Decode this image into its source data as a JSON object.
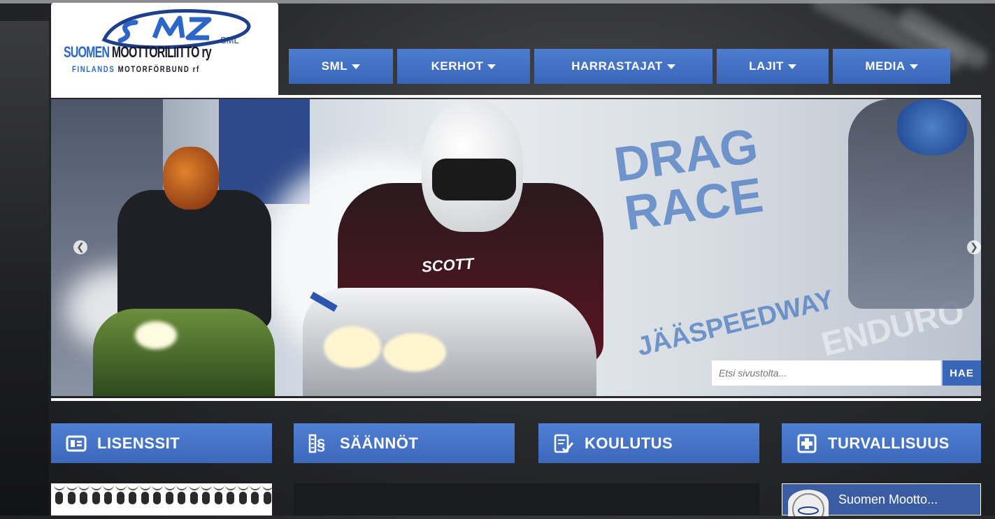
{
  "logo": {
    "mark_text": "SML",
    "name_part1": "SUOMEN",
    "name_part2": "MOOTTORILIITTO",
    "name_part3": "ry",
    "sub_part1": "FINLANDS",
    "sub_part2": "MOTORFÖRBUND rf"
  },
  "nav": {
    "items": [
      {
        "label": "SML"
      },
      {
        "label": "KERHOT"
      },
      {
        "label": "HARRASTAJAT"
      },
      {
        "label": "LAJIT"
      },
      {
        "label": "MEDIA"
      }
    ]
  },
  "hero": {
    "jersey": "SCOTT",
    "drag_line1": "DRAG",
    "drag_line2": "RACE",
    "speedway": "JÄÄSPEEDWAY",
    "enduro": "ENDURO"
  },
  "search": {
    "placeholder": "Etsi sivustolta...",
    "button": "HAE"
  },
  "quick_links": [
    {
      "label": "LISENSSIT",
      "icon": "id-card-icon"
    },
    {
      "label": "SÄÄNNÖT",
      "icon": "rules-paragraph-icon"
    },
    {
      "label": "KOULUTUS",
      "icon": "checklist-icon"
    },
    {
      "label": "TURVALLISUUS",
      "icon": "plus-cross-icon"
    }
  ],
  "facebook": {
    "name": "Suomen Mootto..."
  },
  "colors": {
    "nav_blue": "#3a66b8",
    "logo_blue": "#1d3f8c",
    "accent_blue": "#2d66c9"
  }
}
